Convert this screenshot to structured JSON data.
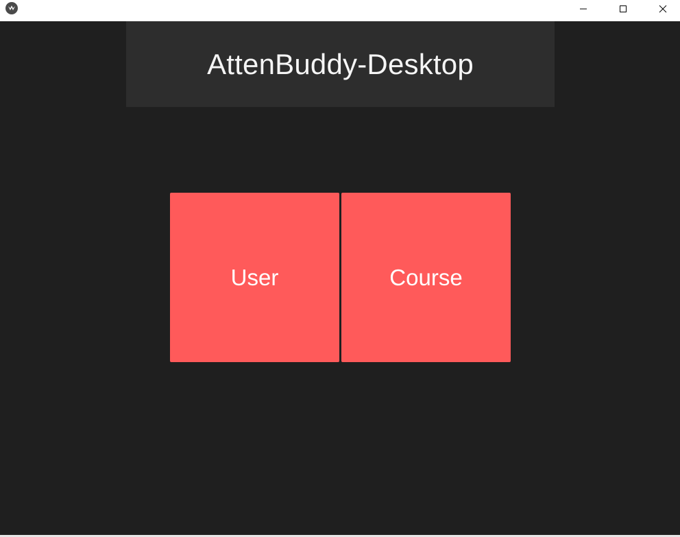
{
  "window": {
    "icon": "kivy-app-icon",
    "controls": {
      "minimize_icon": "minimize-icon",
      "maximize_icon": "maximize-icon",
      "close_icon": "close-icon"
    }
  },
  "header": {
    "title": "AttenBuddy-Desktop"
  },
  "menu": {
    "user_label": "User",
    "course_label": "Course"
  },
  "colors": {
    "background": "#1f1f1f",
    "header_background": "#2d2d2d",
    "tile_accent": "#ff5a5a",
    "text": "#ffffff"
  }
}
